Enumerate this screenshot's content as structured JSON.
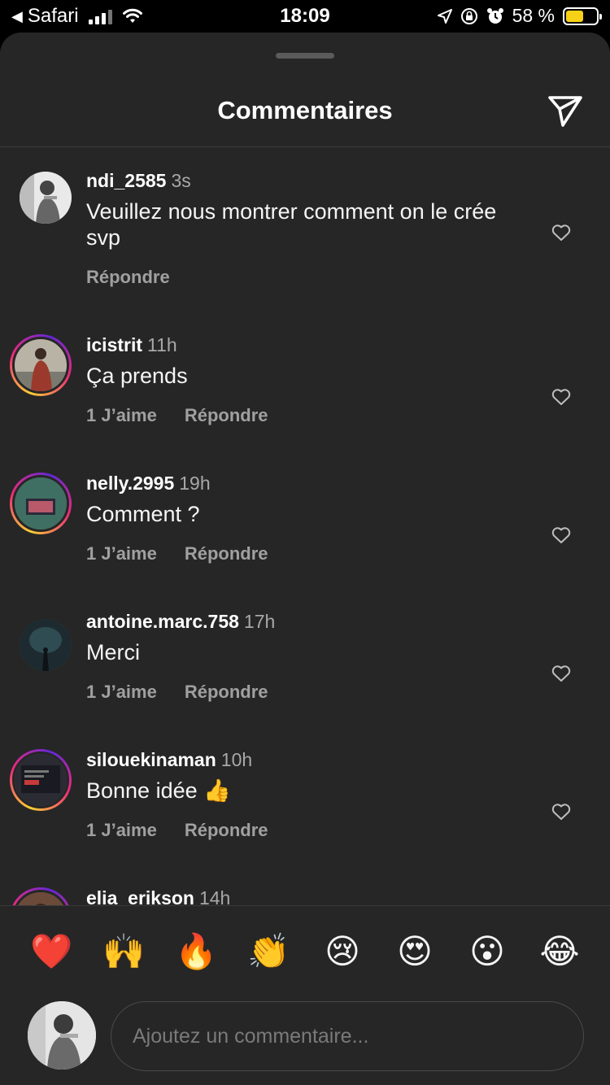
{
  "status_bar": {
    "back_app": "Safari",
    "time": "18:09",
    "battery_percent": "58 %",
    "battery_level": 0.58
  },
  "header": {
    "title": "Commentaires"
  },
  "comments": [
    {
      "username": "ndi_2585",
      "time": "3s",
      "text": "Veuillez nous montrer comment on le crée svp",
      "likes": "",
      "reply": "Répondre"
    },
    {
      "username": "icistrit",
      "time": "11h",
      "text": "Ça prends",
      "likes": "1 J’aime",
      "reply": "Répondre"
    },
    {
      "username": "nelly.2995",
      "time": "19h",
      "text": "Comment ?",
      "likes": "1 J’aime",
      "reply": "Répondre"
    },
    {
      "username": "antoine.marc.758",
      "time": "17h",
      "text": "Merci",
      "likes": "1 J’aime",
      "reply": "Répondre"
    },
    {
      "username": "silouekinaman",
      "time": "10h",
      "text": "Bonne idée 👍",
      "likes": "1 J’aime",
      "reply": "Répondre"
    },
    {
      "username": "elia_erikson",
      "time": "14h",
      "text": "",
      "likes": "",
      "reply": ""
    }
  ],
  "emojis": [
    "❤️",
    "🙌",
    "🔥",
    "👏",
    "😢",
    "😍",
    "😮",
    "😂"
  ],
  "input": {
    "placeholder": "Ajoutez un commentaire..."
  },
  "colors": {
    "background": "#262626",
    "text": "#f5f5f5",
    "muted": "#a8a8a8",
    "battery": "#f7d117"
  }
}
